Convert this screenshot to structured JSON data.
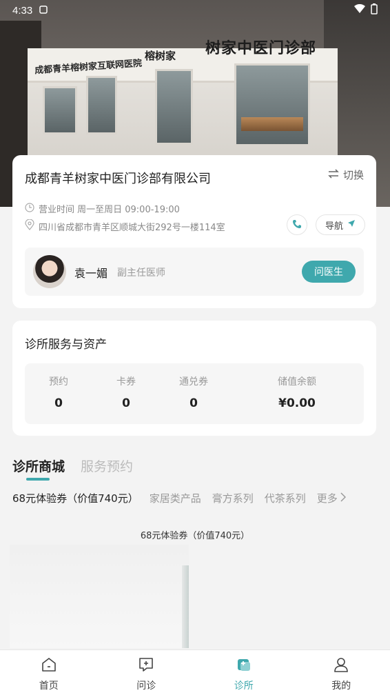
{
  "status_bar": {
    "time": "4:33"
  },
  "hero": {
    "sign_main": "树家中医门诊部",
    "sign_brand": "榕树家",
    "sign_left": "成都青羊榕树家互联网医院"
  },
  "clinic": {
    "name": "成都青羊树家中医门诊部有限公司",
    "switch_label": "切换",
    "hours": "营业时间 周一至周日 09:00-19:00",
    "address": "四川省成都市青羊区顺城大街292号一楼114室",
    "nav_label": "导航",
    "doctor": {
      "name": "袁一媚",
      "title": "副主任医师",
      "ask_label": "问医生"
    }
  },
  "services": {
    "title": "诊所服务与资产",
    "stats": [
      {
        "label": "预约",
        "value": "0"
      },
      {
        "label": "卡券",
        "value": "0"
      },
      {
        "label": "通兑券",
        "value": "0"
      },
      {
        "label": "储值余额",
        "value": "¥0.00"
      }
    ]
  },
  "tabs": [
    {
      "label": "诊所商城"
    },
    {
      "label": "服务预约"
    }
  ],
  "categories": [
    {
      "label": "68元体验券（价值740元）"
    },
    {
      "label": "家居类产品"
    },
    {
      "label": "膏方系列"
    },
    {
      "label": "代茶系列"
    }
  ],
  "more_label": "更多",
  "product": {
    "caption": "68元体验券（价值740元）"
  },
  "bottom_nav": [
    {
      "label": "首页",
      "icon": "home-icon"
    },
    {
      "label": "问诊",
      "icon": "consult-icon"
    },
    {
      "label": "诊所",
      "icon": "clinic-icon"
    },
    {
      "label": "我的",
      "icon": "profile-icon"
    }
  ],
  "colors": {
    "accent": "#3fa8ad"
  }
}
